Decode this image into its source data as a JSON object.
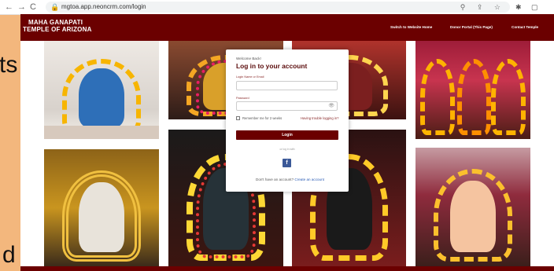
{
  "slide": {
    "text_top": "ts",
    "text_bottom": "d"
  },
  "browser": {
    "back": "←",
    "forward": "→",
    "reload": "C",
    "lock": "🔒",
    "url": "mgtoa.app.neoncrm.com/login",
    "url_icons": "⚲ ⇪ ☆",
    "extension_icons": "✱ ▢ ⋯"
  },
  "header": {
    "brand_line1": "MAHA GANAPATI",
    "brand_line2": "TEMPLE OF ARIZONA",
    "nav": [
      "Switch to Website Home",
      "Donor Portal  (This Page)",
      "Contact Temple"
    ]
  },
  "login": {
    "welcome": "Welcome Back!",
    "title": "Log in to your account",
    "email_label": "Login Name or Email",
    "email_value": "",
    "password_label": "Password",
    "password_value": "",
    "eye": "👁",
    "remember": "Remember me for 2 weeks",
    "trouble": "Having trouble logging in?",
    "login_button": "Login",
    "or_text": "or log in with",
    "facebook": "f",
    "no_account": "Don't have an account? ",
    "create_account": "Create an account"
  },
  "colors": {
    "brand": "#6b0000",
    "slide_bg": "#f3b77d"
  }
}
